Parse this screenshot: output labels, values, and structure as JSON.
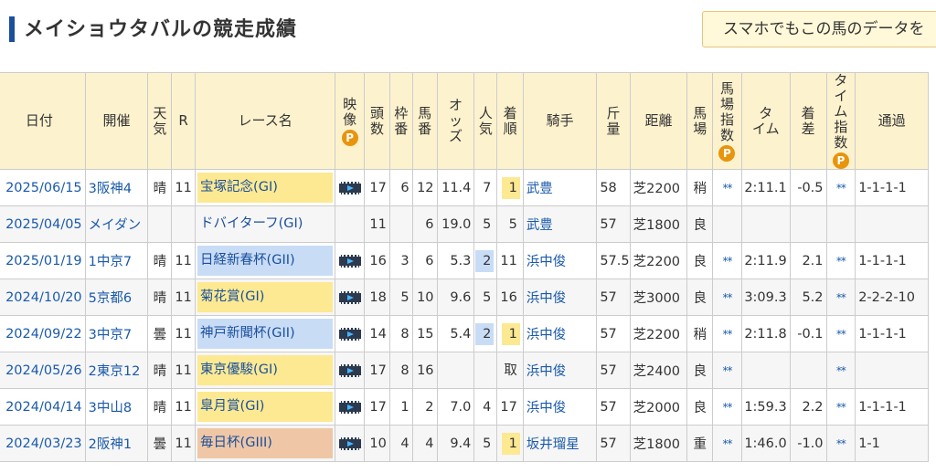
{
  "header": {
    "title": "メイショウタバルの競走成績",
    "smartphone_link": "スマホでもこの馬のデータを"
  },
  "columns": {
    "date": "日付",
    "venue": "開催",
    "weather": "天気",
    "race_no": "R",
    "race_name": "レース名",
    "video": "映像",
    "field_size": "頭数",
    "frame": "枠番",
    "horse_no": "馬番",
    "odds": "オッズ",
    "popularity": "人気",
    "finish": "着順",
    "jockey": "騎手",
    "weight": "斤量",
    "distance": "距離",
    "track": "馬場",
    "track_index": "馬場指数",
    "time": "タイム",
    "margin": "着差",
    "time_index": "タイム指数",
    "passing": "通過",
    "p_badge": "P"
  },
  "rows": [
    {
      "date": "2025/06/15",
      "venue": "3阪神4",
      "weather": "晴",
      "race_no": "11",
      "race_name": "宝塚記念(GI)",
      "grade": "g1",
      "video": true,
      "field_size": "17",
      "frame": "6",
      "horse_no": "12",
      "odds": "11.4",
      "popularity": "7",
      "finish": "1",
      "jockey": "武豊",
      "weight": "58",
      "distance": "芝2200",
      "track": "稍",
      "track_index": "**",
      "time": "2:11.1",
      "margin": "-0.5",
      "time_index": "**",
      "passing": "1-1-1-1"
    },
    {
      "date": "2025/04/05",
      "venue": "メイダン",
      "weather": "",
      "race_no": "",
      "race_name": "ドバイターフ(GI)",
      "grade": "none",
      "video": false,
      "field_size": "11",
      "frame": "",
      "horse_no": "6",
      "odds": "19.0",
      "popularity": "5",
      "finish": "5",
      "jockey": "武豊",
      "weight": "57",
      "distance": "芝1800",
      "track": "良",
      "track_index": "",
      "time": "",
      "margin": "",
      "time_index": "",
      "passing": ""
    },
    {
      "date": "2025/01/19",
      "venue": "1中京7",
      "weather": "晴",
      "race_no": "11",
      "race_name": "日経新春杯(GII)",
      "grade": "g2",
      "video": true,
      "field_size": "16",
      "frame": "3",
      "horse_no": "6",
      "odds": "5.3",
      "popularity": "2",
      "finish": "11",
      "jockey": "浜中俊",
      "weight": "57.5",
      "distance": "芝2200",
      "track": "良",
      "track_index": "**",
      "time": "2:11.9",
      "margin": "2.1",
      "time_index": "**",
      "passing": "1-1-1-1"
    },
    {
      "date": "2024/10/20",
      "venue": "5京都6",
      "weather": "晴",
      "race_no": "11",
      "race_name": "菊花賞(GI)",
      "grade": "g1",
      "video": true,
      "field_size": "18",
      "frame": "5",
      "horse_no": "10",
      "odds": "9.6",
      "popularity": "5",
      "finish": "16",
      "jockey": "浜中俊",
      "weight": "57",
      "distance": "芝3000",
      "track": "良",
      "track_index": "**",
      "time": "3:09.3",
      "margin": "5.2",
      "time_index": "**",
      "passing": "2-2-2-10"
    },
    {
      "date": "2024/09/22",
      "venue": "3中京7",
      "weather": "曇",
      "race_no": "11",
      "race_name": "神戸新聞杯(GII)",
      "grade": "g2",
      "video": true,
      "field_size": "14",
      "frame": "8",
      "horse_no": "15",
      "odds": "5.4",
      "popularity": "2",
      "finish": "1",
      "jockey": "浜中俊",
      "weight": "57",
      "distance": "芝2200",
      "track": "稍",
      "track_index": "**",
      "time": "2:11.8",
      "margin": "-0.1",
      "time_index": "**",
      "passing": "1-1-1-1"
    },
    {
      "date": "2024/05/26",
      "venue": "2東京12",
      "weather": "晴",
      "race_no": "11",
      "race_name": "東京優駿(GI)",
      "grade": "g1",
      "video": true,
      "field_size": "17",
      "frame": "8",
      "horse_no": "16",
      "odds": "",
      "popularity": "",
      "finish": "取",
      "jockey": "浜中俊",
      "weight": "57",
      "distance": "芝2400",
      "track": "良",
      "track_index": "**",
      "time": "",
      "margin": "",
      "time_index": "**",
      "passing": ""
    },
    {
      "date": "2024/04/14",
      "venue": "3中山8",
      "weather": "晴",
      "race_no": "11",
      "race_name": "皐月賞(GI)",
      "grade": "g1",
      "video": true,
      "field_size": "17",
      "frame": "1",
      "horse_no": "2",
      "odds": "7.0",
      "popularity": "4",
      "finish": "17",
      "jockey": "浜中俊",
      "weight": "57",
      "distance": "芝2000",
      "track": "良",
      "track_index": "**",
      "time": "1:59.3",
      "margin": "2.2",
      "time_index": "**",
      "passing": "1-1-1-1"
    },
    {
      "date": "2024/03/23",
      "venue": "2阪神1",
      "weather": "曇",
      "race_no": "11",
      "race_name": "毎日杯(GIII)",
      "grade": "g3",
      "video": true,
      "field_size": "10",
      "frame": "4",
      "horse_no": "4",
      "odds": "9.4",
      "popularity": "5",
      "finish": "1",
      "jockey": "坂井瑠星",
      "weight": "57",
      "distance": "芝1800",
      "track": "重",
      "track_index": "**",
      "time": "1:46.0",
      "margin": "-1.0",
      "time_index": "**",
      "passing": "1-1"
    }
  ]
}
